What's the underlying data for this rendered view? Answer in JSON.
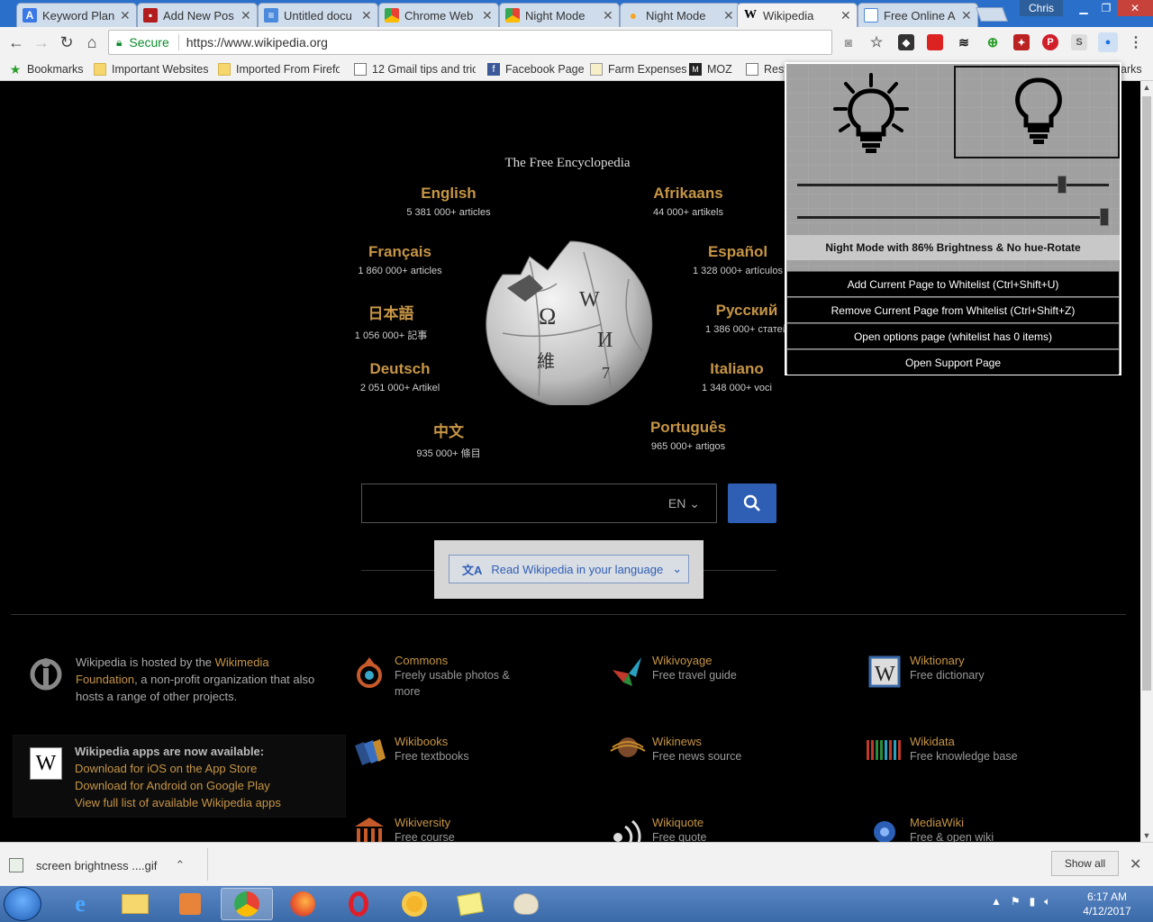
{
  "tabs": [
    {
      "title": "Keyword Plan",
      "icon": "adwords-icon",
      "color": "#3b78e7"
    },
    {
      "title": "Add New Pos",
      "icon": "blog-icon",
      "color": "#b31d1d"
    },
    {
      "title": "Untitled docu",
      "icon": "docs-icon",
      "color": "#4a89dc"
    },
    {
      "title": "Chrome Web",
      "icon": "chrome-webstore-icon",
      "color": "#e94235"
    },
    {
      "title": "Night Mode",
      "icon": "chrome-webstore-icon",
      "color": "#e94235"
    },
    {
      "title": "Night Mode",
      "icon": "bulb-icon",
      "color": "#f5a623"
    },
    {
      "title": "Wikipedia",
      "icon": "wikipedia-icon",
      "color": "#000000"
    },
    {
      "title": "Free Online A",
      "icon": "page-icon",
      "color": "#4a89dc"
    }
  ],
  "profile_name": "Chris",
  "address": {
    "secure_label": "Secure",
    "url": "https://www.wikipedia.org"
  },
  "bookmarks": [
    {
      "label": "Bookmarks",
      "icon": "star-icon"
    },
    {
      "label": "Important Websites",
      "icon": "folder-icon"
    },
    {
      "label": "Imported From Firefo",
      "icon": "folder-icon"
    },
    {
      "label": "12 Gmail tips and tric",
      "icon": "page-icon"
    },
    {
      "label": "Facebook Page",
      "icon": "facebook-icon"
    },
    {
      "label": "Farm Expenses",
      "icon": "sheet-icon"
    },
    {
      "label": "MOZ",
      "icon": "moz-icon"
    },
    {
      "label": "Resta",
      "icon": "page-icon"
    }
  ],
  "bookmarks_overflow": "arks",
  "wiki": {
    "tagline": "The Free Encyclopedia",
    "languages": [
      {
        "name": "English",
        "count": "5 381 000+ articles"
      },
      {
        "name": "Afrikaans",
        "count": "44 000+ artikels"
      },
      {
        "name": "Français",
        "count": "1 860 000+ articles"
      },
      {
        "name": "Español",
        "count": "1 328 000+ artículos"
      },
      {
        "name": "日本語",
        "count": "1 056 000+ 記事"
      },
      {
        "name": "Русский",
        "count": "1 386 000+ статей"
      },
      {
        "name": "Deutsch",
        "count": "2 051 000+ Artikel"
      },
      {
        "name": "Italiano",
        "count": "1 348 000+ voci"
      },
      {
        "name": "中文",
        "count": "935 000+ 條目"
      },
      {
        "name": "Português",
        "count": "965 000+ artigos"
      }
    ],
    "search_lang": "EN",
    "read_lang": "Read Wikipedia in your language",
    "hosted": {
      "pre": "Wikipedia is hosted by the ",
      "link": "Wikimedia Foundation",
      "post": ", a non-profit organization that also hosts a range of other projects."
    },
    "apps": {
      "head": "Wikipedia apps are now available:",
      "ios": "Download for iOS on the App Store",
      "android": "Download for Android on Google Play",
      "all": "View full list of available Wikipedia apps"
    },
    "projects": [
      {
        "name": "Commons",
        "desc": "Freely usable photos & more",
        "icon": "commons-icon"
      },
      {
        "name": "Wikivoyage",
        "desc": "Free travel guide",
        "icon": "wikivoyage-icon"
      },
      {
        "name": "Wiktionary",
        "desc": "Free dictionary",
        "icon": "wiktionary-icon"
      },
      {
        "name": "Wikibooks",
        "desc": "Free textbooks",
        "icon": "wikibooks-icon"
      },
      {
        "name": "Wikinews",
        "desc": "Free news source",
        "icon": "wikinews-icon"
      },
      {
        "name": "Wikidata",
        "desc": "Free knowledge base",
        "icon": "wikidata-icon"
      },
      {
        "name": "Wikiversity",
        "desc": "Free course",
        "icon": "wikiversity-icon"
      },
      {
        "name": "Wikiquote",
        "desc": "Free quote",
        "icon": "wikiquote-icon"
      },
      {
        "name": "MediaWiki",
        "desc": "Free & open wiki",
        "icon": "mediawiki-icon"
      }
    ]
  },
  "popup": {
    "brightness_fraction": 0.86,
    "hue_fraction": 1.0,
    "status": "Night Mode with 86% Brightness & No hue-Rotate",
    "buttons": [
      "Add Current Page to Whitelist (Ctrl+Shift+U)",
      "Remove Current Page from Whitelist (Ctrl+Shift+Z)",
      "Open options page (whitelist has 0 items)",
      "Open Support Page"
    ]
  },
  "download": {
    "file": "screen brightness ....gif",
    "show_all": "Show all"
  },
  "clock": {
    "time": "6:17 AM",
    "date": "4/12/2017"
  },
  "colors": {
    "accent": "#c69545",
    "search_button": "#2f5fb5"
  }
}
